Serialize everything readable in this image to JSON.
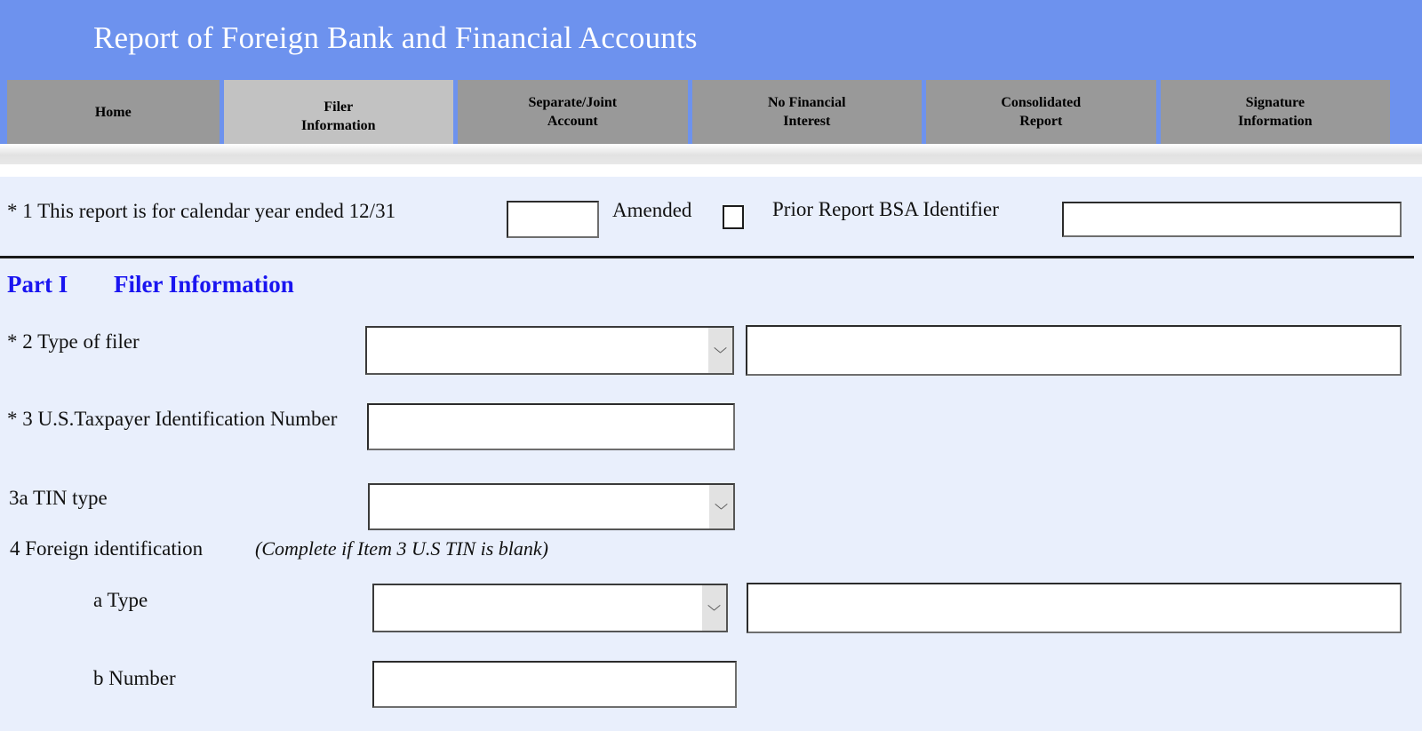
{
  "header": {
    "title": "Report of Foreign Bank and Financial Accounts",
    "band_color": "#6d92ee",
    "title_color": "#ffffff"
  },
  "tabs": {
    "active_index": 1,
    "items": [
      {
        "label": "Home",
        "lines": [
          "Home"
        ]
      },
      {
        "label": "Filer Information",
        "lines": [
          "Filer",
          "Information"
        ]
      },
      {
        "label": "Separate/Joint Account",
        "lines": [
          "Separate/Joint",
          "Account"
        ]
      },
      {
        "label": "No Financial Interest",
        "lines": [
          "No Financial",
          "Interest"
        ]
      },
      {
        "label": "Consolidated Report",
        "lines": [
          "Consolidated",
          "Report"
        ]
      },
      {
        "label": "Signature Information",
        "lines": [
          "Signature",
          "Information"
        ]
      }
    ]
  },
  "form": {
    "item1": {
      "label": "* 1  This report is for calendar year ended 12/31",
      "year_value": "",
      "year_placeholder": "",
      "amended_label": "Amended",
      "amended_checked": false,
      "prior_label": "Prior Report BSA Identifier",
      "prior_value": "",
      "prior_placeholder": ""
    },
    "part": {
      "number": "Part I",
      "title": "Filer Information",
      "color": "#1a15f0"
    },
    "item2": {
      "label": "* 2 Type of filer",
      "select_value": "",
      "detail_value": ""
    },
    "item3": {
      "label": "* 3 U.S.Taxpayer Identification Number",
      "value": ""
    },
    "item3a": {
      "label": "3a TIN type",
      "select_value": ""
    },
    "item4": {
      "label": "4 Foreign identification",
      "hint": "(Complete if Item 3 U.S TIN is blank)"
    },
    "item4a": {
      "label": "a Type",
      "select_value": "",
      "detail_value": ""
    },
    "item4b": {
      "label": "b Number",
      "value": ""
    }
  },
  "icons": {
    "chevron_down": "chevron-down-icon"
  },
  "colors": {
    "page_background": "#e9effc",
    "tab_inactive": "#999999",
    "tab_active": "#c2c2c2",
    "heading_blue": "#1a15f0"
  }
}
